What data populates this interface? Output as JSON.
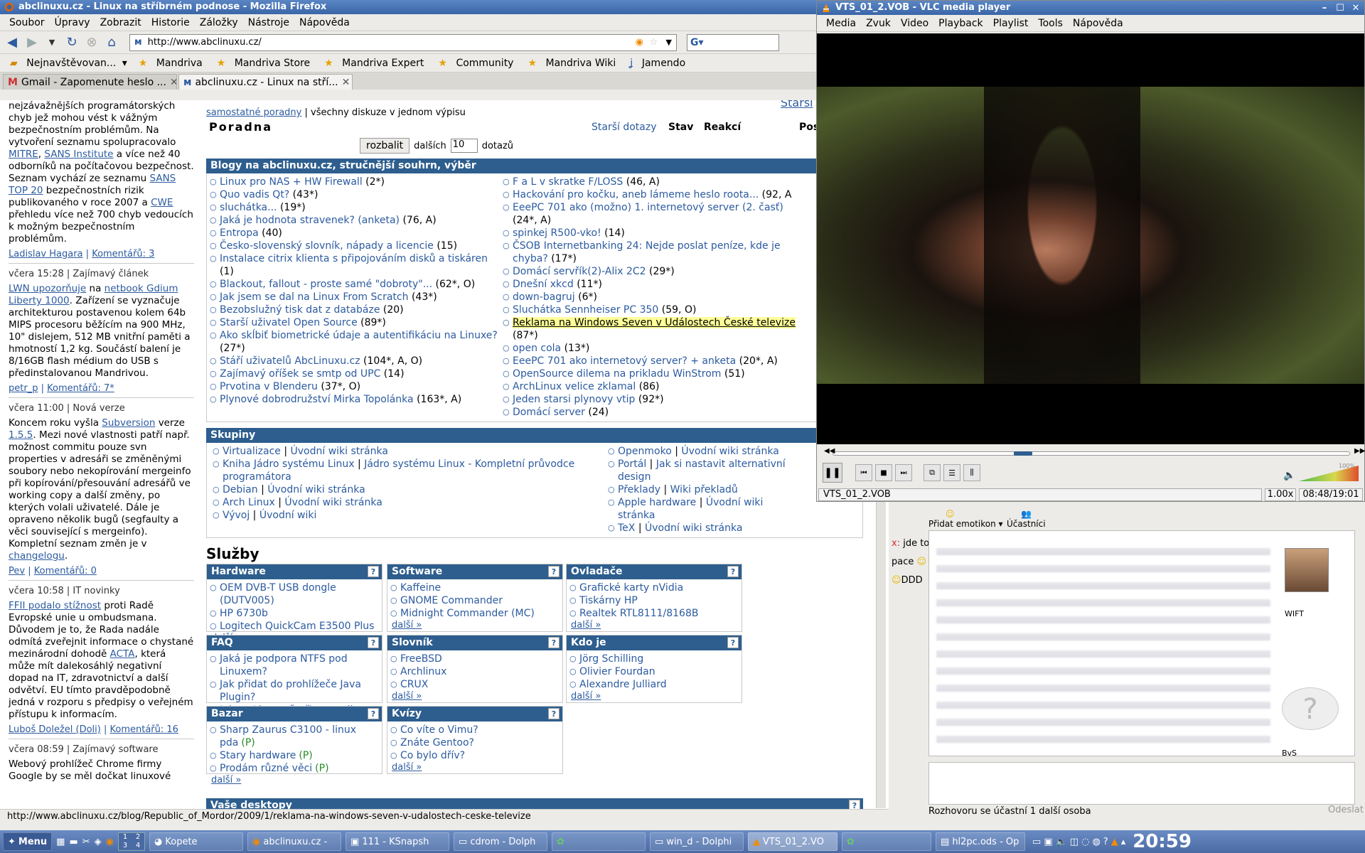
{
  "firefox": {
    "title": "abclinuxu.cz - Linux na stříbrném podnose - Mozilla Firefox",
    "menu": [
      "Soubor",
      "Úpravy",
      "Zobrazit",
      "Historie",
      "Záložky",
      "Nástroje",
      "Nápověda"
    ],
    "url": "http://www.abclinuxu.cz/",
    "bookmarks": [
      "Nejnavštěvovan...",
      "Mandriva",
      "Mandriva Store",
      "Mandriva Expert",
      "Community",
      "Mandriva Wiki",
      "Jamendo"
    ],
    "tabs": [
      "Gmail - Zapomenute heslo ...",
      "abclinuxu.cz - Linux na stří..."
    ],
    "status": "http://www.abclinuxu.cz/blog/Republic_of_Mordor/2009/1/reklama-na-windows-seven-v-udalostech-ceske-televize"
  },
  "left": {
    "p1a": "nejzávažnějších programátorských chyb jež mohou vést k vážným bezpečnostním problémům. Na vytvoření seznamu spolupracovalo ",
    "p1l1": "MITRE",
    "p1b": ", ",
    "p1l2": "SANS Institute",
    "p1c": " a více než 40 odborníků na počítačovou bezpečnost. Seznam vychází ze seznamu ",
    "p1l3": "SANS TOP 20",
    "p1d": " bezpečnostních rizik publikovaného v roce 2007 a ",
    "p1l4": "CWE",
    "p1e": " přehledu více než 700 chyb vedoucích k možným bezpečnostním problémům.",
    "m1a": "Ladislav Hagara",
    "m1b": "Komentářů: 3",
    "h2": "včera 15:28 | Zajímavý článek",
    "p2l1": "LWN upozorňuje",
    "p2a": " na ",
    "p2l2": "netbook Gdium Liberty 1000",
    "p2b": ". Zařízení se vyznačuje architekturou postavenou kolem 64b MIPS procesoru běžícím na 900 MHz, 10\" dislejem, 512 MB vnitřní paměti a hmotností 1,2 kg. Součástí balení je 8/16GB flash médium do USB s předinstalovanou Mandrivou.",
    "m2a": "petr_p",
    "m2b": "Komentářů: 7*",
    "h3": "včera 11:00 | Nová verze",
    "p3a": "Koncem roku vyšla ",
    "p3l1": "Subversion",
    "p3b": " verze ",
    "p3l2": "1.5.5",
    "p3c": ". Mezi nové vlastnosti patří např. možnost commitu pouze svn properties v adresáři se změněnými soubory nebo nekopírování mergeinfo při kopírování/přesouvání adresářů ve working copy a další změny, po kterých volali uživatelé. Dále je opraveno několik bugů (segfaulty a věci související s mergeinfo). Kompletní seznam změn je v ",
    "p3l3": "changelogu",
    "p3d": ".",
    "m3a": "Pev",
    "m3b": "Komentářů: 0",
    "h4": "včera 10:58 | IT novinky",
    "p4l1": "FFII podalo stížnost",
    "p4a": " proti Radě Evropské unie u ombudsmana. Důvodem je to, že Rada nadále odmítá zveřejnit informace o chystané mezinárodní dohodě ",
    "p4l2": "ACTA",
    "p4b": ", která může mít dalekosáhlý negativní dopad na IT, zdravotnictví a další odvětví. EU tímto pravděpodobně jedná v rozporu s předpisy o veřejném přístupu k informacím.",
    "m4a": "Luboš Doležel (Doli)",
    "m4b": "Komentářů: 16",
    "h5": "včera 08:59 | Zajímavý software",
    "p5": "Webový prohlížeč Chrome firmy Google by se měl dočkat linuxové"
  },
  "main": {
    "toplink": "samostatné poradny",
    "toptext": " | všechny diskuze v jednom výpisu",
    "starsi": "Starší",
    "poradna": "Poradna",
    "older": "Starší dotazy",
    "stav": "Stav",
    "reakci": "Reakcí",
    "pos": "Pos",
    "rozbalit": "rozbalit",
    "dalsich": "dalších",
    "count": "10",
    "dotazu": "dotazů",
    "blogs_title": "Blogy na abclinuxu.cz, stručnější souhrn, výběr",
    "blogs_left": [
      [
        "Linux pro NAS + HW Firewall",
        " (2*)"
      ],
      [
        "Quo vadis Qt?",
        " (43*)"
      ],
      [
        "sluchátka...",
        " (19*)"
      ],
      [
        "Jaká je hodnota stravenek? (anketa)",
        " (76, A)"
      ],
      [
        "Entropa",
        " (40)"
      ],
      [
        "Česko-slovenský slovník, nápady a licencie",
        " (15)"
      ],
      [
        "Instalace citrix klienta s připojováním disků a tiskáren",
        " (1)"
      ],
      [
        "Blackout, fallout - proste samé \"dobroty\"...",
        " (62*, O)"
      ],
      [
        "Jak jsem se dal na Linux From Scratch",
        " (43*)"
      ],
      [
        "Bezobslužný tisk dat z databáze",
        " (20)"
      ],
      [
        "Starší uživatel Open Source",
        " (89*)"
      ],
      [
        "Ako skĺbiť biometrické údaje a autentifikáciu na Linuxe?",
        " (27*)"
      ],
      [
        "Stáří uživatelů AbcLinuxu.cz",
        " (104*, A, O)"
      ],
      [
        "Zajímavý oříšek se smtp od UPC",
        " (14)"
      ],
      [
        "Prvotina v Blenderu",
        " (37*, O)"
      ],
      [
        "Plynové dobrodružství Mirka Topolánka",
        " (163*, A)"
      ]
    ],
    "blogs_right": [
      [
        "F a L v skratke F/LOSS",
        " (46, A)"
      ],
      [
        "Hackování pro kočku, aneb lámeme heslo roota...",
        " (92, A"
      ],
      [
        "EeePC 701 ako (možno) 1. internetový server (2. časť)",
        " (24*, A)"
      ],
      [
        "spinkej R500-vko!",
        " (14)"
      ],
      [
        "ČSOB Internetbanking 24: Nejde poslat peníze, kde je chyba?",
        " (17*)"
      ],
      [
        "Domácí servřík(2)-Alix 2C2",
        " (29*)"
      ],
      [
        "Dnešní xkcd",
        " (11*)"
      ],
      [
        "down-bagruj",
        " (6*)"
      ],
      [
        "Sluchátka Sennheiser PC 350",
        " (59, O)"
      ],
      [
        "Reklama na Windows Seven v Událostech České televize",
        " (87*)"
      ],
      [
        "open cola",
        " (13*)"
      ],
      [
        "EeePC 701 ako internetový server? + anketa",
        " (20*, A)"
      ],
      [
        "OpenSource dilema na prikladu WinStrom",
        " (51)"
      ],
      [
        "ArchLinux velice zklamal",
        " (86)"
      ],
      [
        "Jeden starsi plynovy vtip",
        " (92*)"
      ],
      [
        "Domácí server",
        " (24)"
      ]
    ],
    "groups_title": "Skupiny",
    "groups_left": [
      [
        "Virtualizace",
        "Úvodní wiki stránka"
      ],
      [
        "Kniha Jádro systému Linux",
        "Jádro systému Linux - Kompletní průvodce programátora"
      ],
      [
        "Debian",
        "Úvodní wiki stránka"
      ],
      [
        "Arch Linux",
        "Úvodní wiki stránka"
      ],
      [
        "Vývoj",
        "Úvodní wiki"
      ]
    ],
    "groups_right": [
      [
        "Openmoko",
        "Úvodní wiki stránka"
      ],
      [
        "Portál",
        "Jak si nastavit alternativní design"
      ],
      [
        "Překlady",
        "Wiki překladů"
      ],
      [
        "Apple hardware",
        "Úvodní wiki stránka"
      ],
      [
        "TeX",
        "Úvodní wiki stránka"
      ]
    ],
    "services_title": "Služby",
    "svc": [
      {
        "title": "Hardware",
        "items": [
          "OEM DVB-T USB dongle (DUTV005)",
          "HP 6730b",
          "Logitech QuickCam E3500 Plus"
        ]
      },
      {
        "title": "Software",
        "items": [
          "Kaffeine",
          "GNOME Commander",
          "Midnight Commander (MC)"
        ]
      },
      {
        "title": "Ovladače",
        "items": [
          "Grafické karty nVidia",
          "Tiskárny HP",
          "Realtek RTL8111/8168B"
        ]
      },
      {
        "title": "FAQ",
        "items": [
          "Jaká je podpora NTFS pod Linuxem?",
          "Jak přidat do prohlížeče Java Plugin?",
          "Jak na Linuxu šetřit energii"
        ]
      },
      {
        "title": "Slovník",
        "items": [
          "FreeBSD",
          "Archlinux",
          "CRUX"
        ]
      },
      {
        "title": "Kdo je",
        "items": [
          "Jörg Schilling",
          "Olivier Fourdan",
          "Alexandre Julliard"
        ]
      },
      {
        "title": "Bazar",
        "items": [
          "Sharp Zaurus C3100 - linux pda",
          "Stary hardware",
          "Prodám různé věci"
        ],
        "tags": [
          "(P)",
          "(P)",
          "(P)"
        ]
      },
      {
        "title": "Kvízy",
        "items": [
          "Co víte o Vimu?",
          "Znáte Gentoo?",
          "Co bylo dřív?"
        ]
      }
    ],
    "more": "další »",
    "desktops": "Vaše desktopy",
    "q": "?"
  },
  "vlc": {
    "title": "VTS_01_2.VOB - VLC media player",
    "menu": [
      "Media",
      "Zvuk",
      "Video",
      "Playback",
      "Playlist",
      "Tools",
      "Nápověda"
    ],
    "file": "VTS_01_2.VOB",
    "speed": "1.00x",
    "time": "08:48/19:01",
    "progress": 0.35,
    "volume_label": "100%"
  },
  "kopete": {
    "tb1": "Přidat emotikon",
    "tb2": "Účastníci",
    "side1": "jde to",
    "side2": "pace",
    "side3": "DDD",
    "name1": "WIFT",
    "name2": "BvS",
    "status": "Rozhovoru se účastní 1 další osoba",
    "send": "Odeslat"
  },
  "taskbar": {
    "menu": "Menu",
    "desk": [
      "1",
      "2",
      "3",
      "4"
    ],
    "items": [
      "Kopete",
      "abclinuxu.cz -",
      "111 - KSnapsh",
      "cdrom - Dolph",
      "",
      "win_d - Dolphi",
      "VTS_01_2.VO",
      "",
      "hl2pc.ods - Op"
    ],
    "clock": "20:59"
  }
}
